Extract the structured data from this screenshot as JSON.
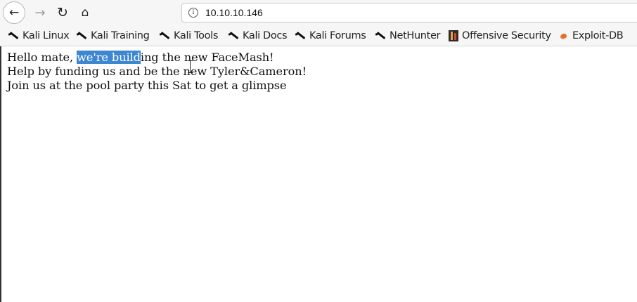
{
  "nav": {
    "back_glyph": "←",
    "forward_glyph": "→",
    "reload_glyph": "↻",
    "home_glyph": "⌂",
    "url": "10.10.10.146",
    "info_glyph": "i"
  },
  "bookmarks": [
    {
      "label": "Kali Linux",
      "icon": "kali-dragon-icon"
    },
    {
      "label": "Kali Training",
      "icon": "kali-dragon-icon"
    },
    {
      "label": "Kali Tools",
      "icon": "kali-dragon-icon"
    },
    {
      "label": "Kali Docs",
      "icon": "kali-dragon-icon"
    },
    {
      "label": "Kali Forums",
      "icon": "kali-dragon-icon"
    },
    {
      "label": "NetHunter",
      "icon": "kali-dragon-icon"
    },
    {
      "label": "Offensive Security",
      "icon": "offensive-security-icon"
    },
    {
      "label": "Exploit-DB",
      "icon": "exploit-db-icon"
    }
  ],
  "page": {
    "line1_before": "Hello mate, ",
    "line1_selected": "we're build",
    "line1_after": "ing the new FaceMash!",
    "line2": "Help by funding us and be the new Tyler&Cameron!",
    "line3": "Join us at the pool party this Sat to get a glimpse"
  },
  "colors": {
    "selection": "#3d86d0",
    "toolbar_bg": "#f6f6f7"
  }
}
